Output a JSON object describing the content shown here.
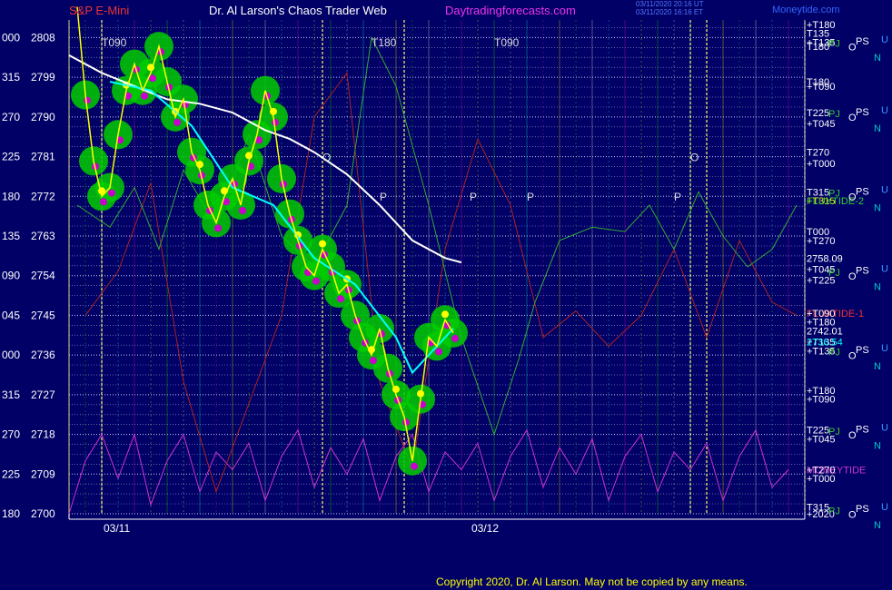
{
  "header": {
    "symbol": "S&P E-Mini",
    "title": "Dr. Al Larson's Chaos Trader Web",
    "site": "Daytradingforecasts.com",
    "timestamp_1": "03/11/2020 20:16 UT",
    "timestamp_2": "03/11/2020 16:16 ET",
    "brand": "Moneytide.com"
  },
  "copyright": "Copyright 2020, Dr. Al Larson. May not be copied by any means.",
  "colors": {
    "background": "#000066",
    "price": "#ffff00",
    "moneytide1": "#00ffff",
    "average": "#ffffff",
    "glow": "#00cc00",
    "flux_green": "#33aa33",
    "flux_red": "#aa2222",
    "moneytide_pink": "#cc33cc"
  },
  "chart_data": {
    "type": "line",
    "title": "S&P E-Mini",
    "ylim": [
      2700,
      2812
    ],
    "y_ticks": [
      {
        "price": "2808",
        "code": "000"
      },
      {
        "price": "2799",
        "code": "315"
      },
      {
        "price": "2790",
        "code": "270"
      },
      {
        "price": "2781",
        "code": "225"
      },
      {
        "price": "2772",
        "code": "180"
      },
      {
        "price": "2763",
        "code": "135"
      },
      {
        "price": "2754",
        "code": "090"
      },
      {
        "price": "2745",
        "code": "045"
      },
      {
        "price": "2736",
        "code": "000"
      },
      {
        "price": "2727",
        "code": "315"
      },
      {
        "price": "2718",
        "code": "270"
      },
      {
        "price": "2709",
        "code": "225"
      },
      {
        "price": "2700",
        "code": "180"
      }
    ],
    "x_labels": [
      "03/11",
      "03/12"
    ],
    "markers": [
      {
        "text": "T090",
        "x": 4,
        "y": 2806
      },
      {
        "text": "T180",
        "x": 37,
        "y": 2806
      },
      {
        "text": "T090",
        "x": 52,
        "y": 2806
      },
      {
        "text": "O",
        "x": 31,
        "y": 2780
      },
      {
        "text": "P",
        "x": 38,
        "y": 2771
      },
      {
        "text": "P",
        "x": 49,
        "y": 2771
      },
      {
        "text": "P",
        "x": 56,
        "y": 2771
      },
      {
        "text": "P",
        "x": 74,
        "y": 2771
      },
      {
        "text": "O",
        "x": 76,
        "y": 2780
      }
    ],
    "right_labels": [
      {
        "text": "+T180",
        "color": "#ffffff",
        "y": 2811
      },
      {
        "text": "T135",
        "color": "#ffffff",
        "y": 2809
      },
      {
        "text": "+T135",
        "color": "#ffffff",
        "y": 2807
      },
      {
        "text": "T180",
        "color": "#ffffff",
        "y": 2806
      },
      {
        "text": "T180",
        "color": "#ffffff",
        "y": 2798
      },
      {
        "text": "+T090",
        "color": "#ffffff",
        "y": 2797
      },
      {
        "text": "T225",
        "color": "#ffffff",
        "y": 2791
      },
      {
        "text": "+T045",
        "color": "#ffffff",
        "y": 2788.5
      },
      {
        "text": "T270",
        "color": "#ffffff",
        "y": 2782
      },
      {
        "text": "+T000",
        "color": "#ffffff",
        "y": 2779.5
      },
      {
        "text": "T315",
        "color": "#ffffff",
        "y": 2773
      },
      {
        "text": "+T315",
        "color": "#ffff00",
        "y": 2771
      },
      {
        "text": "FLUXTIDE-2",
        "color": "#33cc33",
        "y": 2771
      },
      {
        "text": "T000",
        "color": "#ffffff",
        "y": 2764
      },
      {
        "text": "+T270",
        "color": "#ffffff",
        "y": 2762
      },
      {
        "text": "2758.09",
        "color": "#ffffff",
        "y": 2758
      },
      {
        "text": "+T045",
        "color": "#ffffff",
        "y": 2755.5
      },
      {
        "text": "+T225",
        "color": "#ffffff",
        "y": 2753
      },
      {
        "text": "FLUXTIDE-1",
        "color": "#ee3333",
        "y": 2745.5
      },
      {
        "text": "+T090",
        "color": "#ffffff",
        "y": 2745.5
      },
      {
        "text": "+T180",
        "color": "#ffffff",
        "y": 2743.5
      },
      {
        "text": "2742.01",
        "color": "#ffffff",
        "y": 2741.5
      },
      {
        "text": "+T135",
        "color": "#ffffff",
        "y": 2739
      },
      {
        "text": "2736.54",
        "color": "#00ffff",
        "y": 2739
      },
      {
        "text": "+T135",
        "color": "#ffffff",
        "y": 2737
      },
      {
        "text": "+T180",
        "color": "#ffffff",
        "y": 2728
      },
      {
        "text": "+T090",
        "color": "#ffffff",
        "y": 2726
      },
      {
        "text": "T225",
        "color": "#ffffff",
        "y": 2719
      },
      {
        "text": "+T045",
        "color": "#ffffff",
        "y": 2717
      },
      {
        "text": "MONEYTIDE",
        "color": "#cc33cc",
        "y": 2710
      },
      {
        "text": "+T270",
        "color": "#ffffff",
        "y": 2710
      },
      {
        "text": "+T000",
        "color": "#ffffff",
        "y": 2708
      },
      {
        "text": "T315",
        "color": "#ffffff",
        "y": 2701.5
      },
      {
        "text": "+2020",
        "color": "#ffffff",
        "y": 2700
      }
    ],
    "planet_rows": [
      {
        "letters": [
          "PJ",
          "O"
        ],
        "y": 2808
      },
      {
        "letters": [
          "PS",
          "U",
          "N"
        ],
        "y": 2806
      },
      {
        "letters": [
          "PJ",
          "O"
        ],
        "y": 2792
      },
      {
        "letters": [
          "PS",
          "U",
          "N"
        ],
        "y": 2790
      },
      {
        "letters": [
          "PJ",
          "O"
        ],
        "y": 2774
      },
      {
        "letters": [
          "PS",
          "U",
          "N"
        ],
        "y": 2772
      },
      {
        "letters": [
          "PJ",
          "O"
        ],
        "y": 2756
      },
      {
        "letters": [
          "PS",
          "U",
          "N"
        ],
        "y": 2754
      },
      {
        "letters": [
          "PJ",
          "O"
        ],
        "y": 2738
      },
      {
        "letters": [
          "PS",
          "U",
          "N"
        ],
        "y": 2736
      },
      {
        "letters": [
          "PJ",
          "O"
        ],
        "y": 2720
      },
      {
        "letters": [
          "PS",
          "U",
          "N"
        ],
        "y": 2718
      },
      {
        "letters": [
          "PJ",
          "O"
        ],
        "y": 2702
      },
      {
        "letters": [
          "PS",
          "U",
          "N"
        ],
        "y": 2700
      }
    ],
    "series": [
      {
        "name": "Price",
        "color": "#ffff00",
        "points": [
          [
            1,
            2815
          ],
          [
            2,
            2795
          ],
          [
            3,
            2780
          ],
          [
            4,
            2772
          ],
          [
            5,
            2774
          ],
          [
            6,
            2786
          ],
          [
            7,
            2796
          ],
          [
            8,
            2802
          ],
          [
            9,
            2796
          ],
          [
            10,
            2800
          ],
          [
            11,
            2806
          ],
          [
            12,
            2798
          ],
          [
            13,
            2790
          ],
          [
            14,
            2794
          ],
          [
            15,
            2782
          ],
          [
            16,
            2778
          ],
          [
            17,
            2770
          ],
          [
            18,
            2766
          ],
          [
            19,
            2772
          ],
          [
            20,
            2776
          ],
          [
            21,
            2770
          ],
          [
            22,
            2780
          ],
          [
            23,
            2786
          ],
          [
            24,
            2796
          ],
          [
            25,
            2790
          ],
          [
            26,
            2776
          ],
          [
            27,
            2768
          ],
          [
            28,
            2762
          ],
          [
            29,
            2756
          ],
          [
            30,
            2754
          ],
          [
            31,
            2760
          ],
          [
            32,
            2756
          ],
          [
            33,
            2750
          ],
          [
            34,
            2752
          ],
          [
            35,
            2745
          ],
          [
            36,
            2740
          ],
          [
            37,
            2736
          ],
          [
            38,
            2742
          ],
          [
            39,
            2733
          ],
          [
            40,
            2727
          ],
          [
            41,
            2722
          ],
          [
            42,
            2712
          ],
          [
            43,
            2726
          ],
          [
            44,
            2740
          ],
          [
            45,
            2738
          ],
          [
            46,
            2744
          ],
          [
            47,
            2741
          ]
        ]
      },
      {
        "name": "MoneyTide",
        "color": "#00ffff",
        "points": [
          [
            5,
            2798
          ],
          [
            10,
            2796
          ],
          [
            15,
            2788
          ],
          [
            20,
            2774
          ],
          [
            25,
            2770
          ],
          [
            30,
            2758
          ],
          [
            35,
            2752
          ],
          [
            40,
            2740
          ],
          [
            42,
            2732
          ],
          [
            44,
            2736
          ],
          [
            47,
            2742
          ]
        ]
      },
      {
        "name": "Average",
        "color": "#ffffff",
        "points": [
          [
            0,
            2804
          ],
          [
            4,
            2800
          ],
          [
            8,
            2797
          ],
          [
            12,
            2794
          ],
          [
            16,
            2793
          ],
          [
            20,
            2791
          ],
          [
            24,
            2787
          ],
          [
            27,
            2785
          ],
          [
            30,
            2782
          ],
          [
            34,
            2777
          ],
          [
            38,
            2770
          ],
          [
            42,
            2762
          ],
          [
            46,
            2758
          ],
          [
            48,
            2757
          ]
        ]
      },
      {
        "name": "FLUXTIDE-2",
        "color": "#33aa33",
        "points": [
          [
            1,
            2770
          ],
          [
            5,
            2765
          ],
          [
            8,
            2774
          ],
          [
            11,
            2760
          ],
          [
            14,
            2778
          ],
          [
            18,
            2765
          ],
          [
            22,
            2786
          ],
          [
            26,
            2763
          ],
          [
            30,
            2756
          ],
          [
            34,
            2770
          ],
          [
            37,
            2808
          ],
          [
            40,
            2797
          ],
          [
            44,
            2770
          ],
          [
            48,
            2740
          ],
          [
            52,
            2718
          ],
          [
            55,
            2735
          ],
          [
            57,
            2748
          ],
          [
            60,
            2762
          ],
          [
            64,
            2765
          ],
          [
            68,
            2764
          ],
          [
            71,
            2770
          ],
          [
            74,
            2760
          ],
          [
            77,
            2773
          ],
          [
            80,
            2763
          ],
          [
            83,
            2756
          ],
          [
            86,
            2760
          ],
          [
            89,
            2770
          ]
        ]
      },
      {
        "name": "FLUXTIDE-1",
        "color": "#aa2222",
        "points": [
          [
            2,
            2745
          ],
          [
            6,
            2755
          ],
          [
            10,
            2775
          ],
          [
            14,
            2730
          ],
          [
            18,
            2705
          ],
          [
            22,
            2725
          ],
          [
            26,
            2745
          ],
          [
            30,
            2790
          ],
          [
            34,
            2800
          ],
          [
            38,
            2730
          ],
          [
            42,
            2710
          ],
          [
            46,
            2760
          ],
          [
            50,
            2785
          ],
          [
            54,
            2770
          ],
          [
            58,
            2740
          ],
          [
            62,
            2746
          ],
          [
            66,
            2738
          ],
          [
            70,
            2745
          ],
          [
            74,
            2760
          ],
          [
            78,
            2740
          ],
          [
            82,
            2762
          ],
          [
            86,
            2748
          ],
          [
            89,
            2745
          ]
        ]
      },
      {
        "name": "MONEYTIDE",
        "color": "#cc33cc",
        "points": [
          [
            0,
            2700
          ],
          [
            2,
            2712
          ],
          [
            4,
            2718
          ],
          [
            6,
            2708
          ],
          [
            8,
            2718
          ],
          [
            10,
            2702
          ],
          [
            12,
            2712
          ],
          [
            14,
            2718
          ],
          [
            16,
            2705
          ],
          [
            18,
            2714
          ],
          [
            20,
            2710
          ],
          [
            22,
            2716
          ],
          [
            24,
            2703
          ],
          [
            26,
            2713
          ],
          [
            28,
            2719
          ],
          [
            30,
            2706
          ],
          [
            32,
            2715
          ],
          [
            34,
            2709
          ],
          [
            36,
            2717
          ],
          [
            38,
            2703
          ],
          [
            40,
            2713
          ],
          [
            42,
            2718
          ],
          [
            44,
            2705
          ],
          [
            46,
            2714
          ],
          [
            48,
            2710
          ],
          [
            50,
            2716
          ],
          [
            52,
            2703
          ],
          [
            54,
            2713
          ],
          [
            56,
            2719
          ],
          [
            58,
            2706
          ],
          [
            60,
            2715
          ],
          [
            62,
            2709
          ],
          [
            64,
            2717
          ],
          [
            66,
            2703
          ],
          [
            68,
            2713
          ],
          [
            70,
            2718
          ],
          [
            72,
            2705
          ],
          [
            74,
            2714
          ],
          [
            76,
            2710
          ],
          [
            78,
            2716
          ],
          [
            80,
            2703
          ],
          [
            82,
            2713
          ],
          [
            84,
            2719
          ],
          [
            86,
            2706
          ],
          [
            88,
            2710
          ]
        ]
      }
    ]
  }
}
